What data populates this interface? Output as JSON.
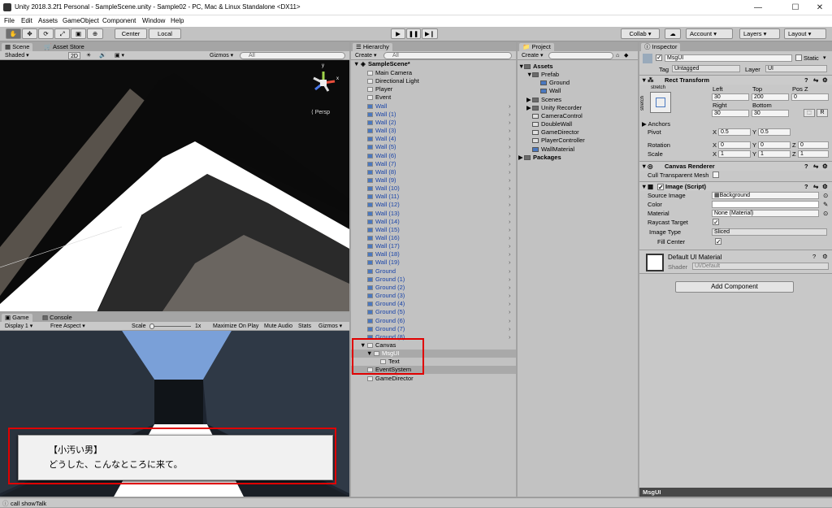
{
  "window": {
    "title": "Unity 2018.3.2f1 Personal - SampleScene.unity - Sample02 - PC, Mac & Linux Standalone <DX11>",
    "minimize": "—",
    "maximize": "☐",
    "close": "✕"
  },
  "menu": [
    "File",
    "Edit",
    "Assets",
    "GameObject",
    "Component",
    "Window",
    "Help"
  ],
  "toolbar": {
    "pivot_center": "Center",
    "pivot_local": "Local",
    "collab": "Collab ▾",
    "account": "Account",
    "layers": "Layers",
    "layout": "Layout"
  },
  "scene_panel": {
    "tabs": [
      "Scene",
      "Asset Store"
    ],
    "shading": "Shaded",
    "mode_2d": "2D",
    "gizmos": "Gizmos",
    "search_placeholder": "All",
    "persp_label": "Persp",
    "gizmo_y": "y",
    "gizmo_x": "x"
  },
  "game_panel": {
    "tabs": [
      "Game",
      "Console"
    ],
    "display": "Display 1",
    "aspect": "Free Aspect",
    "scale_label": "Scale",
    "scale_value": "1x",
    "maximize": "Maximize On Play",
    "mute": "Mute Audio",
    "stats": "Stats",
    "gizmos": "Gizmos",
    "dialog_speaker": "【小汚い男】",
    "dialog_text": "どうした、こんなところに来て。"
  },
  "hierarchy": {
    "tab": "Hierarchy",
    "create": "Create",
    "search_placeholder": "All",
    "scene": "SampleScene*",
    "items": [
      "Main Camera",
      "Directional Light",
      "Player",
      "Event",
      "Wall",
      "Wall (1)",
      "Wall (2)",
      "Wall (3)",
      "Wall (4)",
      "Wall (5)",
      "Wall (6)",
      "Wall (7)",
      "Wall (8)",
      "Wall (9)",
      "Wall (10)",
      "Wall (11)",
      "Wall (12)",
      "Wall (13)",
      "Wall (14)",
      "Wall (15)",
      "Wall (16)",
      "Wall (17)",
      "Wall (18)",
      "Wall (19)",
      "Ground",
      "Ground (1)",
      "Ground (2)",
      "Ground (3)",
      "Ground (4)",
      "Ground (5)",
      "Ground (6)",
      "Ground (7)",
      "Ground (8)",
      "Canvas",
      "MsgUI",
      "Text",
      "EventSystem",
      "GameDirector"
    ]
  },
  "project": {
    "tab": "Project",
    "create": "Create",
    "items": [
      "Assets",
      "Prefab",
      "Ground",
      "Wall",
      "Scenes",
      "Unity Recorder",
      "CameraControl",
      "DoubleWall",
      "GameDirector",
      "PlayerController",
      "WallMaterial",
      "Packages"
    ]
  },
  "inspector": {
    "tab": "Inspector",
    "object_name": "MsgUI",
    "static_label": "Static",
    "tag_label": "Tag",
    "tag_value": "Untagged",
    "layer_label": "Layer",
    "layer_value": "UI",
    "rect_transform": {
      "title": "Rect Transform",
      "stretch_top": "stretch",
      "stretch_side": "stretch",
      "left_label": "Left",
      "left": "30",
      "top_label": "Top",
      "top": "200",
      "posz_label": "Pos Z",
      "posz": "0",
      "right_label": "Right",
      "right": "30",
      "bottom_label": "Bottom",
      "bottom": "30",
      "r_button": "R",
      "anchors": "Anchors",
      "pivot_label": "Pivot",
      "pivot_x": "0.5",
      "pivot_y": "0.5",
      "rotation_label": "Rotation",
      "rot_x": "0",
      "rot_y": "0",
      "rot_z": "0",
      "scale_label": "Scale",
      "scale_x": "1",
      "scale_y": "1",
      "scale_z": "1",
      "x": "X",
      "y": "Y",
      "z": "Z"
    },
    "canvas_renderer": {
      "title": "Canvas Renderer",
      "cull": "Cull Transparent Mesh"
    },
    "image": {
      "title": "Image (Script)",
      "source_label": "Source Image",
      "source_value": "Background",
      "color_label": "Color",
      "material_label": "Material",
      "material_value": "None (Material)",
      "raycast_label": "Raycast Target",
      "image_type_label": "Image Type",
      "image_type_value": "Sliced",
      "fill_center_label": "Fill Center"
    },
    "material": {
      "name": "Default UI Material",
      "shader_label": "Shader",
      "shader_value": "UI/Default"
    },
    "add_component": "Add Component",
    "preview_label": "MsgUI"
  },
  "status_bar": {
    "message": "call showTalk"
  },
  "colors": {
    "highlight": "#e00000",
    "selection": "#8f8f8f",
    "unity_blue": "#1843a8"
  }
}
